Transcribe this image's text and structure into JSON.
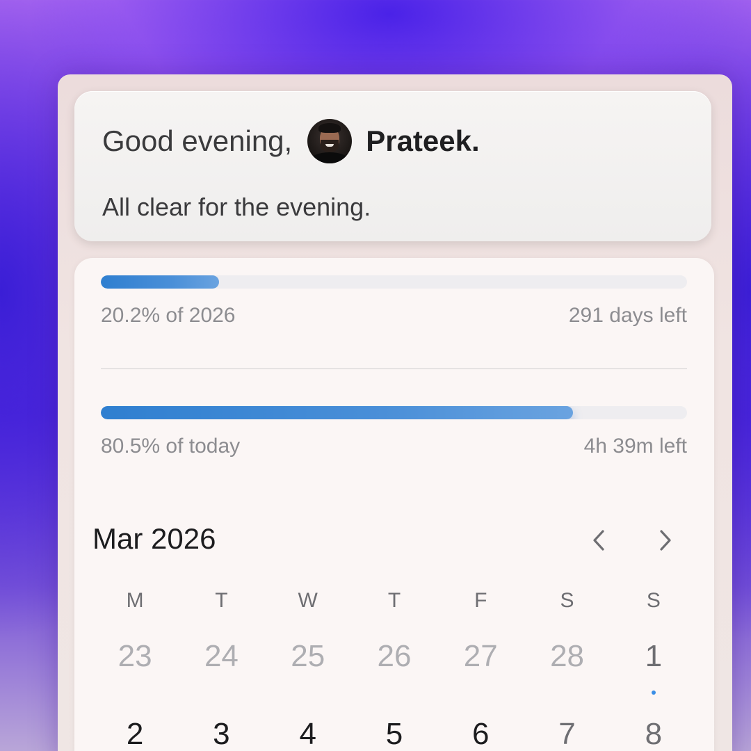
{
  "greeting": {
    "prefix": "Good evening,",
    "name": "Prateek.",
    "subtitle": "All clear for the evening."
  },
  "year_progress": {
    "percent": 20.2,
    "label": "20.2% of 2026",
    "remaining": "291 days left"
  },
  "day_progress": {
    "percent": 80.5,
    "label": "80.5% of today",
    "remaining": "4h 39m left"
  },
  "calendar": {
    "title": "Mar 2026",
    "prev_icon": "chevron-left-icon",
    "next_icon": "chevron-right-icon",
    "weekdays": [
      "M",
      "T",
      "W",
      "T",
      "F",
      "S",
      "S"
    ],
    "weeks": [
      [
        {
          "label": "23",
          "state": "muted"
        },
        {
          "label": "24",
          "state": "muted"
        },
        {
          "label": "25",
          "state": "muted"
        },
        {
          "label": "26",
          "state": "muted"
        },
        {
          "label": "27",
          "state": "muted"
        },
        {
          "label": "28",
          "state": "muted"
        },
        {
          "label": "1",
          "state": "weekend",
          "event_dot": true
        }
      ],
      [
        {
          "label": "2",
          "state": "current"
        },
        {
          "label": "3",
          "state": "current"
        },
        {
          "label": "4",
          "state": "current"
        },
        {
          "label": "5",
          "state": "current"
        },
        {
          "label": "6",
          "state": "current"
        },
        {
          "label": "7",
          "state": "weekend"
        },
        {
          "label": "8",
          "state": "weekend"
        }
      ]
    ]
  },
  "colors": {
    "progress_fill": "#2f7fd0",
    "event_dot": "#3a8ee6",
    "background_accent": "#5a2de0"
  }
}
